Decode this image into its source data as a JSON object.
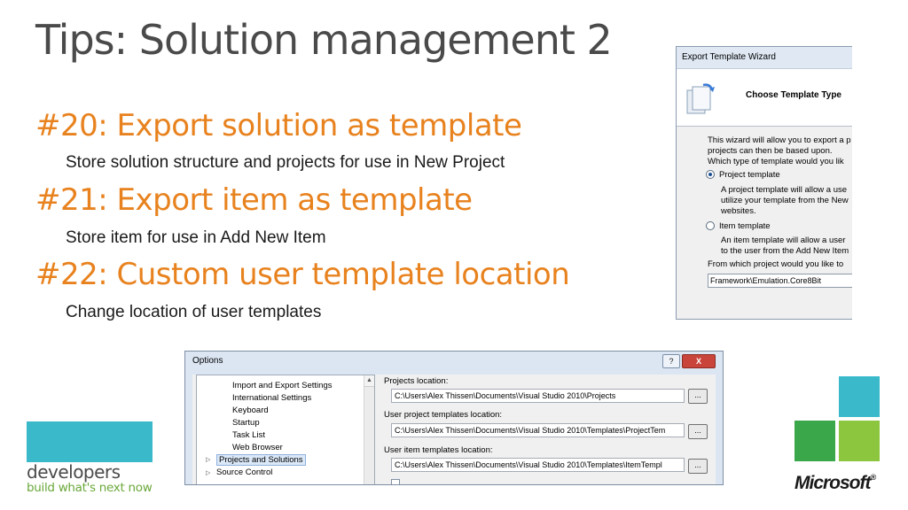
{
  "slide": {
    "title": "Tips: Solution management 2",
    "tips": [
      {
        "heading": "#20: Export solution as template",
        "sub": "Store solution structure and projects for use in New Project"
      },
      {
        "heading": "#21: Export item as template",
        "sub": "Store item for use in Add New Item"
      },
      {
        "heading": "#22: Custom user template location",
        "sub": "Change location of user templates"
      }
    ]
  },
  "wizard": {
    "window_title": "Export Template Wizard",
    "heading": "Choose Template Type",
    "intro_lines": [
      "This wizard will allow you to export a p",
      "projects can then be based upon."
    ],
    "question": "Which type of template would you lik",
    "project_option": "Project template",
    "project_desc": [
      "A project template will allow a use",
      "utilize your template from the New",
      "websites."
    ],
    "item_option": "Item template",
    "item_desc": [
      "An item template will allow a user",
      "to the user from the Add New Item"
    ],
    "from_label": "From which project would you like to",
    "project_select": "Framework\\Emulation.Core8Bit"
  },
  "options": {
    "window_title": "Options",
    "help_btn": "?",
    "close_btn": "X",
    "tree": [
      "Import and Export Settings",
      "International Settings",
      "Keyboard",
      "Startup",
      "Task List",
      "Web Browser",
      "Projects and Solutions",
      "Source Control"
    ],
    "projects_label": "Projects location:",
    "projects_value": "C:\\Users\\Alex Thissen\\Documents\\Visual Studio 2010\\Projects",
    "user_proj_label": "User project templates location:",
    "user_proj_value": "C:\\Users\\Alex Thissen\\Documents\\Visual Studio 2010\\Templates\\ProjectTem",
    "user_item_label": "User item templates location:",
    "user_item_value": "C:\\Users\\Alex Thissen\\Documents\\Visual Studio 2010\\Templates\\ItemTempl",
    "browse": "..."
  },
  "branding": {
    "developers": "developers",
    "tagline": "build what's next now",
    "microsoft": "Microsoft",
    "trademark": "®"
  },
  "colors": {
    "accent_orange": "#e8821e",
    "tile_teal": "#3ab9cb",
    "tile_green_dark": "#3aa84a",
    "tile_green_light": "#8cc63f"
  }
}
